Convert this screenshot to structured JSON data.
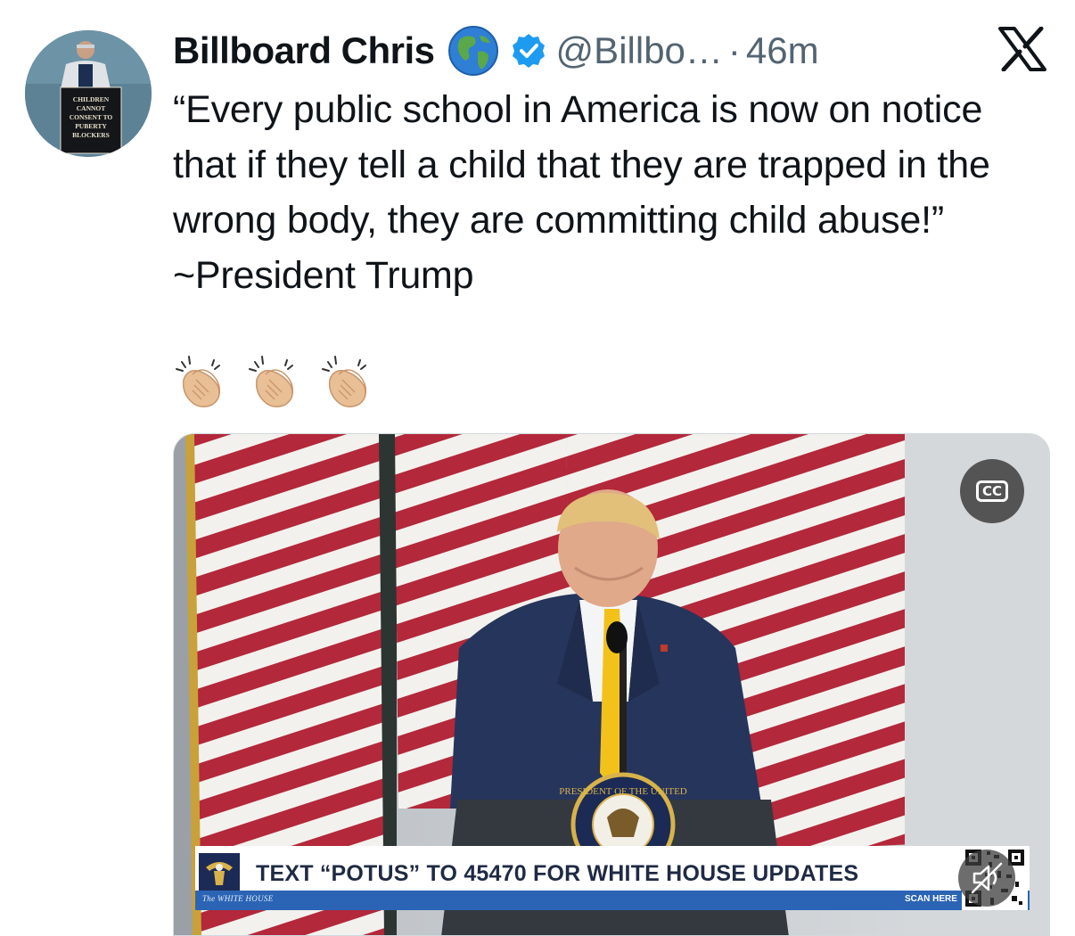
{
  "author": {
    "display_name": "Billboard Chris",
    "handle": "@Billbo…",
    "separator": "·",
    "time": "46m",
    "avatar_sign_lines": [
      "CHILDREN",
      "CANNOT",
      "CONSENT TO",
      "PUBERTY",
      "BLOCKERS"
    ]
  },
  "tweet": {
    "text": "“Every public school in America is now on notice that if they tell a child that they are trapped in the wrong body, they are committing child abuse!” ~President Trump",
    "emojis": [
      "👏🏼",
      "👏🏼",
      "👏🏼"
    ]
  },
  "media": {
    "cc_label": "CC",
    "banner_text": "TEXT “POTUS” TO 45470 FOR WHITE HOUSE UPDATES",
    "banner_footer": "The WHITE HOUSE",
    "scan_here": "SCAN HERE",
    "seal_text": "PRESIDENT OF THE UNITED"
  },
  "icons": {
    "globe": "globe-icon",
    "verified": "verified-badge-icon",
    "x_logo": "x-logo-icon",
    "mute": "mute-icon",
    "cc": "closed-captions-icon"
  },
  "colors": {
    "verified_blue": "#1d9bf0",
    "handle_gray": "#536471",
    "flag_red": "#b3283a",
    "suit_navy": "#26355c",
    "tie_yellow": "#f2c21b"
  }
}
